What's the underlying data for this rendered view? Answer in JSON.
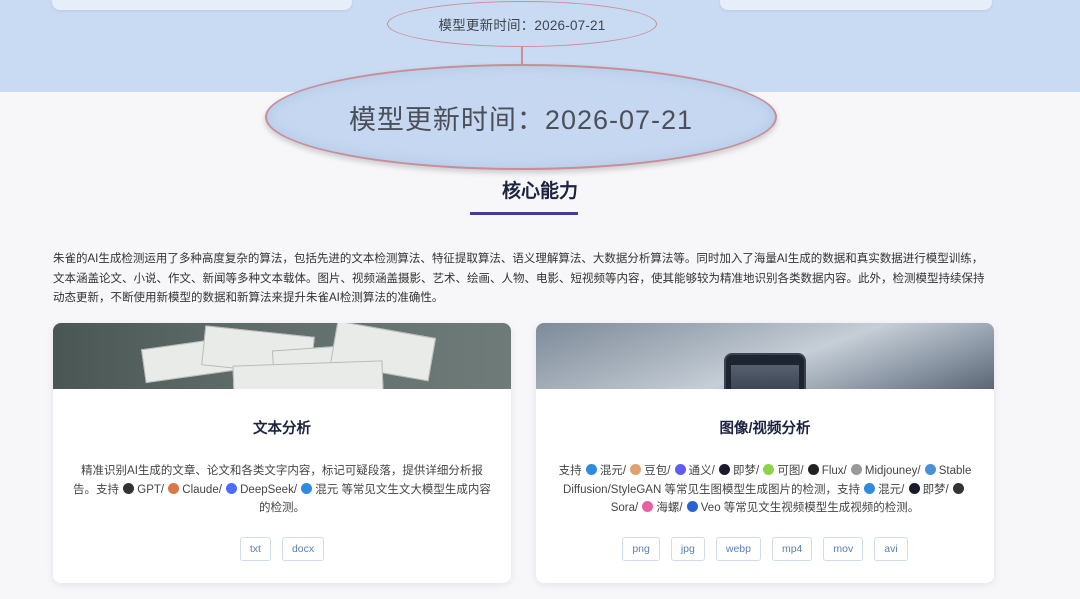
{
  "model_update": {
    "label_small": "模型更新时间：2026-07-21",
    "label_big": "模型更新时间：2026-07-21"
  },
  "section": {
    "title": "核心能力",
    "intro": "朱雀的AI生成检测运用了多种高度复杂的算法，包括先进的文本检测算法、特征提取算法、语义理解算法、大数据分析算法等。同时加入了海量AI生成的数据和真实数据进行模型训练，文本涵盖论文、小说、作文、新闻等多种文本载体。图片、视频涵盖摄影、艺术、绘画、人物、电影、短视频等内容，使其能够较为精准地识别各类数据内容。此外，检测模型持续保持动态更新，不断使用新模型的数据和新算法来提升朱雀AI检测算法的准确性。"
  },
  "text_card": {
    "title": "文本分析",
    "desc_prefix": "精准识别AI生成的文章、论文和各类文字内容，标记可疑段落，提供详细分析报告。支持",
    "brands": [
      {
        "name": "GPT/",
        "icon": "openai-icon",
        "color": "#333333"
      },
      {
        "name": "Claude/",
        "icon": "claude-icon",
        "color": "#d9774b"
      },
      {
        "name": "DeepSeek/",
        "icon": "deepseek-icon",
        "color": "#4d6bfe"
      },
      {
        "name": "混元",
        "icon": "hunyuan-icon",
        "color": "#2f8ae0"
      }
    ],
    "desc_suffix": "等常见文生文大模型生成内容的检测。",
    "formats": [
      "txt",
      "docx"
    ]
  },
  "image_card": {
    "title": "图像/视频分析",
    "desc_start": "支持",
    "image_brands": [
      {
        "name": "混元/",
        "icon": "hunyuan-icon",
        "color": "#2f8ae0"
      },
      {
        "name": "豆包/",
        "icon": "doubao-icon",
        "color": "#e0a070"
      },
      {
        "name": "通义/",
        "icon": "tongyi-icon",
        "color": "#615ced"
      },
      {
        "name": "即梦/",
        "icon": "jimeng-icon",
        "color": "#1a1a2e"
      },
      {
        "name": "可图/",
        "icon": "kolors-icon",
        "color": "#8bd34a"
      },
      {
        "name": "Flux/",
        "icon": "flux-icon",
        "color": "#222222"
      },
      {
        "name": "Midjouney/",
        "icon": "midjourney-icon",
        "color": "#999999"
      },
      {
        "name": "Stable Diffusion/StyleGAN",
        "icon": "stable-diffusion-icon",
        "color": "#4a90d9"
      }
    ],
    "desc_mid": "等常见生图模型生成图片的检测，支持",
    "video_brands": [
      {
        "name": "混元/",
        "icon": "hunyuan-icon",
        "color": "#2f8ae0"
      },
      {
        "name": "即梦/",
        "icon": "jimeng-icon",
        "color": "#1a1a2e"
      },
      {
        "name": "Sora/",
        "icon": "openai-icon",
        "color": "#333333"
      },
      {
        "name": "海螺/",
        "icon": "hailuo-icon",
        "color": "#e85fa6"
      },
      {
        "name": "Veo",
        "icon": "veo-icon",
        "color": "#2a62d6"
      }
    ],
    "desc_end": "等常见文生视频模型生成视频的检测。",
    "formats": [
      "png",
      "jpg",
      "webp",
      "mp4",
      "mov",
      "avi"
    ]
  }
}
